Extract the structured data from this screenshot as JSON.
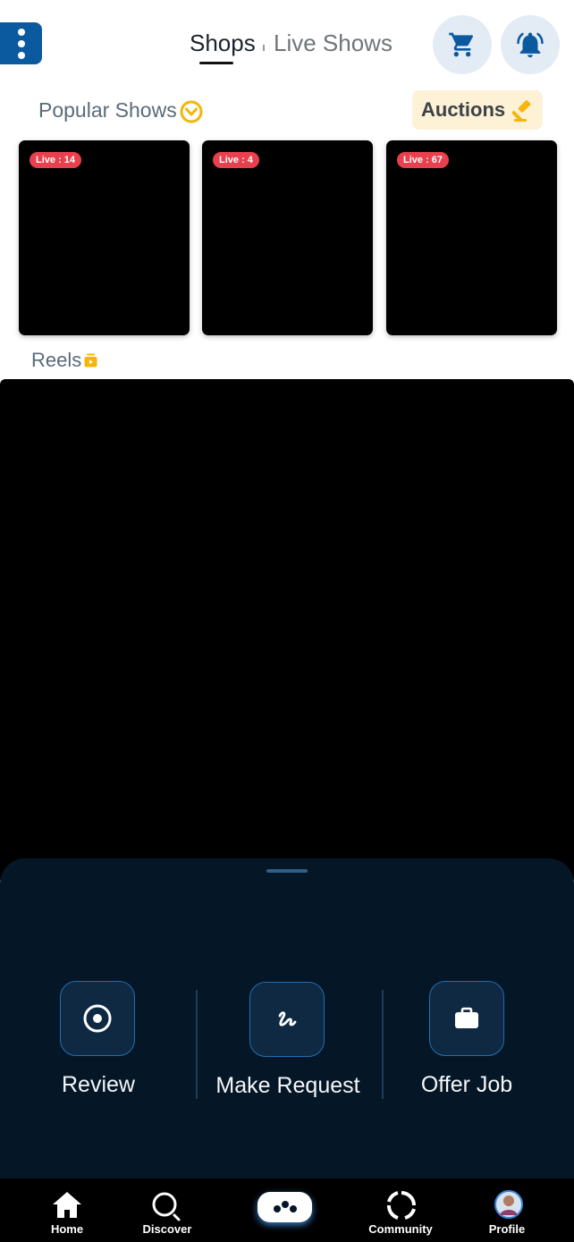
{
  "header": {
    "tabs": [
      {
        "label": "Shops",
        "active": true
      },
      {
        "label": "Live Shows",
        "active": false
      }
    ]
  },
  "popular": {
    "title": "Popular Shows",
    "auctions_label": "Auctions",
    "shows": [
      {
        "badge": "Live : 14"
      },
      {
        "badge": "Live : 4"
      },
      {
        "badge": "Live : 67"
      }
    ]
  },
  "reels": {
    "title": "Reels"
  },
  "sheet": {
    "actions": [
      {
        "label": "Review",
        "icon": "target-icon"
      },
      {
        "label": "Make Request",
        "icon": "scribble-icon"
      },
      {
        "label": "Offer Job",
        "icon": "briefcase-icon"
      }
    ]
  },
  "nav": {
    "items": [
      {
        "label": "Home",
        "icon": "home-icon"
      },
      {
        "label": "Discover",
        "icon": "search-icon"
      },
      {
        "label": "",
        "icon": "menu-dots-icon"
      },
      {
        "label": "Community",
        "icon": "community-icon"
      },
      {
        "label": "Profile",
        "icon": "avatar"
      }
    ]
  },
  "colors": {
    "primary": "#0b5aa0",
    "live_badge": "#e9404e",
    "auction_bg": "#fdf1d6",
    "accent_gold": "#f5b50a",
    "sheet_bg": "#051626"
  }
}
